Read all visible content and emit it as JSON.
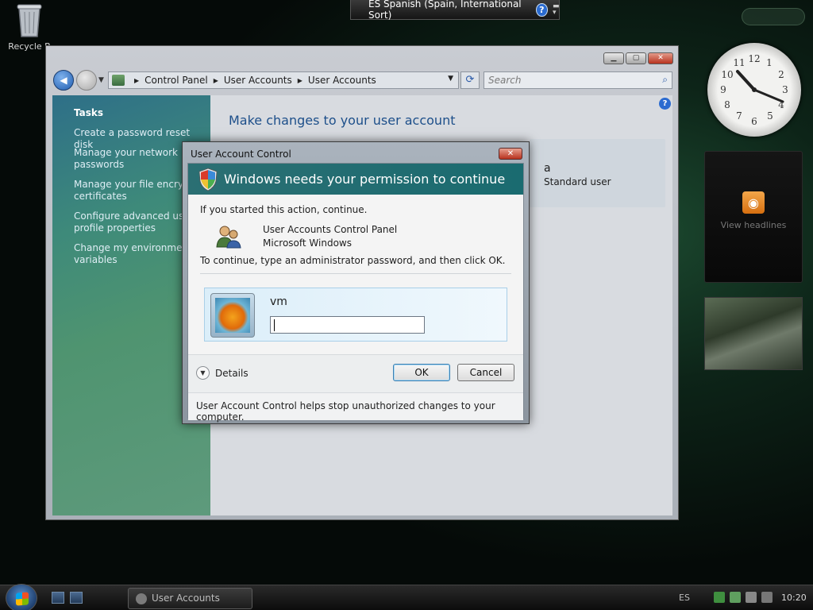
{
  "desktop": {
    "recycle_bin_label": "Recycle B",
    "language_bar": "ES Spanish (Spain, International Sort)",
    "language_bar_help": "?",
    "gadgets": {
      "feed_label": "View headlines"
    }
  },
  "window": {
    "breadcrumb": [
      "Control Panel",
      "User Accounts",
      "User Accounts"
    ],
    "search_placeholder": "Search",
    "help_glyph": "?",
    "left_pane": {
      "heading": "Tasks",
      "tasks": [
        "Create a password reset disk",
        "Manage your network\npasswords",
        "Manage your file encrypti\ncertificates",
        "Configure advanced user\nprofile properties",
        "Change my environment\nvariables"
      ]
    },
    "main": {
      "heading": "Make changes to your user account",
      "account_name": "a",
      "account_role": "Standard user"
    }
  },
  "uac": {
    "title": "User Account Control",
    "banner": "Windows needs your permission to continue",
    "line1": "If you started this action, continue.",
    "program_name": "User Accounts Control Panel",
    "program_publisher": "Microsoft Windows",
    "line2": "To continue, type an administrator password, and then click OK.",
    "username": "vm",
    "password_value": "",
    "details_label": "Details",
    "ok_label": "OK",
    "cancel_label": "Cancel",
    "footer": "User Account Control helps stop unauthorized changes to your computer."
  },
  "taskbar": {
    "active_task": "User Accounts",
    "tray_language": "ES",
    "clock": "10:20"
  }
}
